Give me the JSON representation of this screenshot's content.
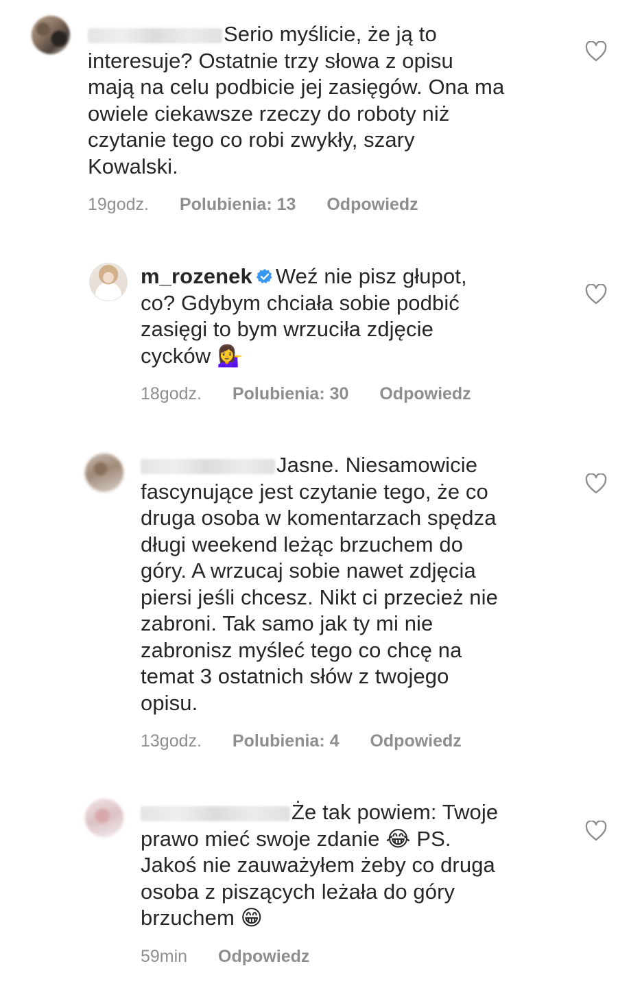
{
  "comments": [
    {
      "username": "",
      "text": "Serio myślicie, że ją to\ninteresuje? Ostatnie trzy słowa z opisu\nmają na celu podbicie jej zasięgów. Ona ma\nowiele ciekawsze rzeczy do roboty niż\nczytanie tego co robi zwykły, szary\nKowalski.",
      "time": "19godz.",
      "likes": "Polubienia: 13",
      "reply": "Odpowiedz"
    },
    {
      "username": "m_rozenek",
      "text": "Weź nie pisz głupot,\nco? Gdybym chciała sobie podbić\nzasięgi to bym wrzuciła zdjęcie\ncycków 💁‍♀️",
      "time": "18godz.",
      "likes": "Polubienia: 30",
      "reply": "Odpowiedz"
    },
    {
      "username": "",
      "text": "Jasne. Niesamowicie\nfascynujące jest czytanie tego, że co\ndruga osoba w komentarzach spędza\ndługi weekend leżąc brzuchem do\ngóry. A wrzucaj sobie nawet zdjęcia\npiersi jeśli chcesz. Nikt ci przecież nie\nzabroni. Tak samo jak ty mi nie\nzabronisz myśleć tego co chcę na\ntemat 3 ostatnich słów z twojego\nopisu.",
      "time": "13godz.",
      "likes": "Polubienia: 4",
      "reply": "Odpowiedz"
    },
    {
      "username": "",
      "text": "Że tak powiem: Twoje\nprawo mieć swoje zdanie 😂 PS.\nJakoś nie zauważyłem żeby co druga\nosoba z piszących leżała do góry\nbrzuchem 😁",
      "time": "59min",
      "reply": "Odpowiedz"
    }
  ],
  "icons": {
    "like": "heart-outline-icon",
    "verified": "verified-badge-icon"
  },
  "colors": {
    "text": "#262626",
    "meta": "#8e8e8e",
    "verified": "#3897f0",
    "heart": "#8e8e8e"
  }
}
